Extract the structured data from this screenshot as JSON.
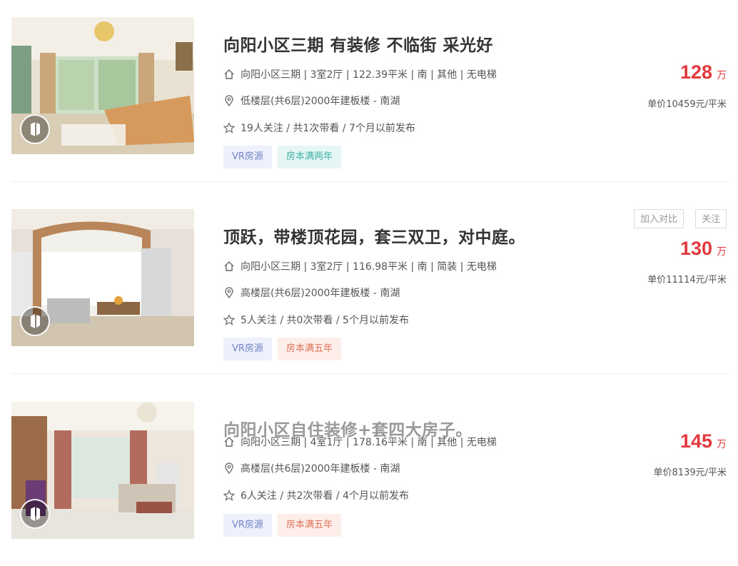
{
  "listings": [
    {
      "title": "向阳小区三期 有装修 不临街 采光好",
      "info": "向阳小区三期 | 3室2厅 | 122.39平米 | 南 | 其他 | 无电梯",
      "floor": "低楼层(共6层)2000年建板楼 - 南湖",
      "follow": "19人关注 / 共1次带看 / 7个月以前发布",
      "tags": [
        "VR房源",
        "房本满两年"
      ],
      "price": "128",
      "price_unit": "万",
      "unit_price": "单价10459元/平米"
    },
    {
      "title": "顶跃，带楼顶花园，套三双卫，对中庭。",
      "info": "向阳小区三期 | 3室2厅 | 116.98平米 | 南 | 简装 | 无电梯",
      "floor": "高楼层(共6层)2000年建板楼 - 南湖",
      "follow": "5人关注 / 共0次带看 / 5个月以前发布",
      "tags": [
        "VR房源",
        "房本满五年"
      ],
      "price": "130",
      "price_unit": "万",
      "unit_price": "单价11114元/平米",
      "actions": {
        "compare": "加入对比",
        "follow": "关注"
      }
    },
    {
      "title": "向阳小区自住装修+套四大房子。",
      "info": "向阳小区三期 | 4室1厅 | 178.16平米 | 南 | 其他 | 无电梯",
      "floor": "高楼层(共6层)2000年建板楼 - 南湖",
      "follow": "6人关注 / 共2次带看 / 4个月以前发布",
      "tags": [
        "VR房源",
        "房本满五年"
      ],
      "price": "145",
      "price_unit": "万",
      "unit_price": "单价8139元/平米"
    }
  ],
  "colors": {
    "price": "#e4393c",
    "tag_vr_bg": "#eef1fb",
    "tag_two_bg": "#e6f6f5",
    "tag_five_bg": "#fdeeea"
  },
  "icons": [
    "house-icon",
    "location-pin-icon",
    "star-icon",
    "vr-icon"
  ]
}
